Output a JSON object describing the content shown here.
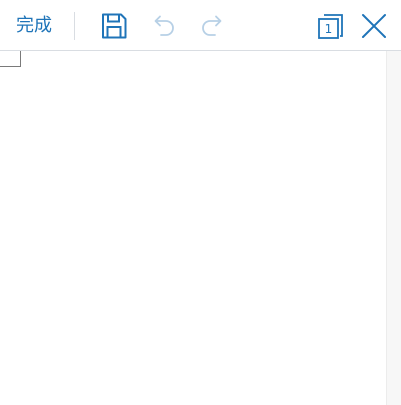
{
  "toolbar": {
    "done_label": "完成",
    "page_count": "1",
    "icons": {
      "save": "save-icon",
      "undo": "undo-icon",
      "redo": "redo-icon",
      "page": "page-icon",
      "close": "close-icon"
    },
    "colors": {
      "accent": "#1f74b8",
      "disabled": "#b7d0e6"
    }
  }
}
